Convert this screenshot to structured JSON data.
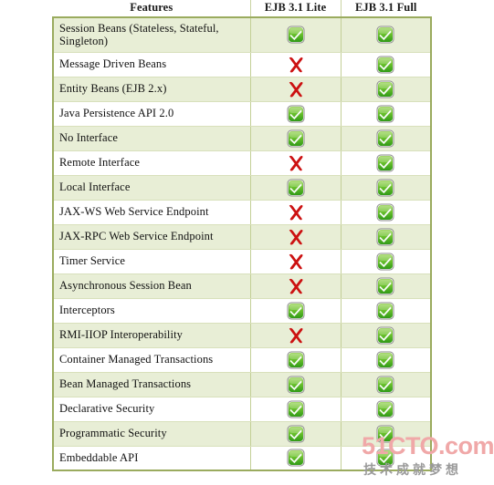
{
  "table": {
    "columns": [
      {
        "key": "feature",
        "label": "Features"
      },
      {
        "key": "lite",
        "label": "EJB 3.1 Lite"
      },
      {
        "key": "full",
        "label": "EJB 3.1 Full"
      }
    ],
    "rows": [
      {
        "feature": "Session Beans (Stateless, Stateful, Singleton)",
        "lite": "check",
        "full": "check"
      },
      {
        "feature": "Message Driven Beans",
        "lite": "cross",
        "full": "check"
      },
      {
        "feature": "Entity Beans (EJB 2.x)",
        "lite": "cross",
        "full": "check"
      },
      {
        "feature": "Java Persistence API 2.0",
        "lite": "check",
        "full": "check"
      },
      {
        "feature": "No Interface",
        "lite": "check",
        "full": "check"
      },
      {
        "feature": "Remote Interface",
        "lite": "cross",
        "full": "check"
      },
      {
        "feature": "Local Interface",
        "lite": "check",
        "full": "check"
      },
      {
        "feature": "JAX-WS Web Service Endpoint",
        "lite": "cross",
        "full": "check"
      },
      {
        "feature": "JAX-RPC Web Service Endpoint",
        "lite": "cross",
        "full": "check"
      },
      {
        "feature": "Timer Service",
        "lite": "cross",
        "full": "check"
      },
      {
        "feature": "Asynchronous Session Bean",
        "lite": "cross",
        "full": "check"
      },
      {
        "feature": "Interceptors",
        "lite": "check",
        "full": "check"
      },
      {
        "feature": "RMI-IIOP Interoperability",
        "lite": "cross",
        "full": "check"
      },
      {
        "feature": "Container Managed Transactions",
        "lite": "check",
        "full": "check"
      },
      {
        "feature": "Bean Managed Transactions",
        "lite": "check",
        "full": "check"
      },
      {
        "feature": "Declarative Security",
        "lite": "check",
        "full": "check"
      },
      {
        "feature": "Programmatic Security",
        "lite": "check",
        "full": "check"
      },
      {
        "feature": "Embeddable API",
        "lite": "check",
        "full": "check"
      }
    ]
  },
  "icons": {
    "check": "green-check-icon",
    "cross": "red-cross-icon"
  },
  "watermark": {
    "logo": "51CTO.com",
    "tagline": "技术成就梦想"
  },
  "colors": {
    "header_border": "#9aab5e",
    "row_alt_bg": "#e8eed6",
    "row_bg": "#ffffff",
    "grid_line": "#c3cf96",
    "check_green": "#4caf28",
    "cross_red": "#cc1111",
    "watermark_pink": "#f0a8a8"
  }
}
